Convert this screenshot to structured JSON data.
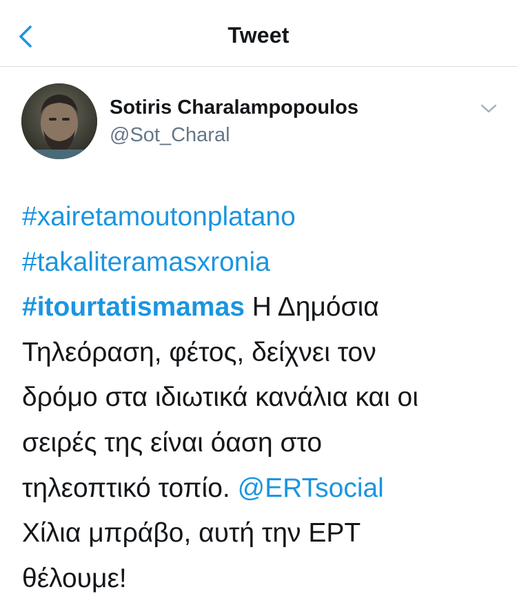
{
  "header": {
    "title": "Tweet",
    "back_icon": "chevron-left-icon"
  },
  "author": {
    "display_name": "Sotiris Charalampopoulos",
    "handle": "@Sot_Charal",
    "more_icon": "chevron-down-icon"
  },
  "tweet": {
    "hashtag1": "#xairetamoutonplatano",
    "hashtag2": "#takaliteramasxronia",
    "hashtag3": "#itourtatismamas",
    "line3_text": " Η Δημόσια",
    "line4_text": "Τηλεόραση, φέτος, δείχνει τον",
    "line5_text": "δρόμο στα ιδιωτικά κανάλια και οι",
    "line6_text": "σειρές της είναι όαση στο",
    "line7_text": "τηλεοπτικό τοπίο. ",
    "mention": "@ERTsocial",
    "line8_text": "Χίλια μπράβο, αυτή την ΕΡΤ",
    "line9_text": "θέλουμε!"
  },
  "colors": {
    "link": "#1b95e0",
    "text": "#14171a",
    "secondary": "#657786",
    "divider": "#d6dadd"
  }
}
